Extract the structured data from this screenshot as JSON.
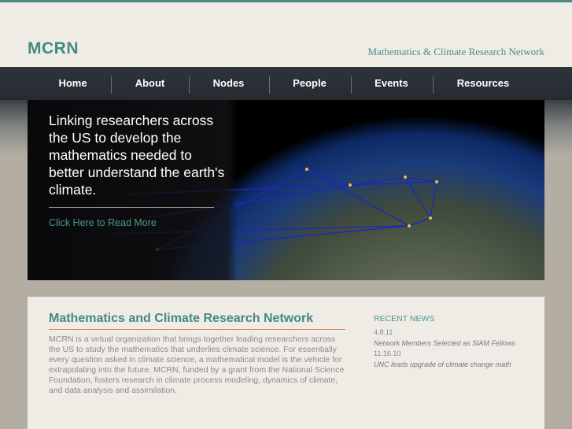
{
  "header": {
    "logo": "MCRN",
    "tagline": "Mathematics & Climate Research Network"
  },
  "nav": [
    "Home",
    "About",
    "Nodes",
    "People",
    "Events",
    "Resources"
  ],
  "hero": {
    "text": "Linking researchers across the US to develop the mathematics needed to better understand the earth's climate.",
    "link": "Click Here to Read More"
  },
  "main": {
    "title": "Mathematics and Climate Research Network",
    "body": "MCRN is a virtual organization that brings together leading researchers across the US to study the mathematics that underlies climate science. For essentially every question asked in climate science, a mathematical model is the vehicle for extrapolating into the future. MCRN, funded by a grant from the National Science Foundation, fosters research in climate process modeling, dynamics of climate, and data analysis and assimilation."
  },
  "news": {
    "heading": "RECENT NEWS",
    "items": [
      {
        "date": "4.8.11",
        "title": "Network Members Selected as SIAM Fellows"
      },
      {
        "date": "11.16.10",
        "title": "UNC leads upgrade of climate change math"
      }
    ]
  }
}
